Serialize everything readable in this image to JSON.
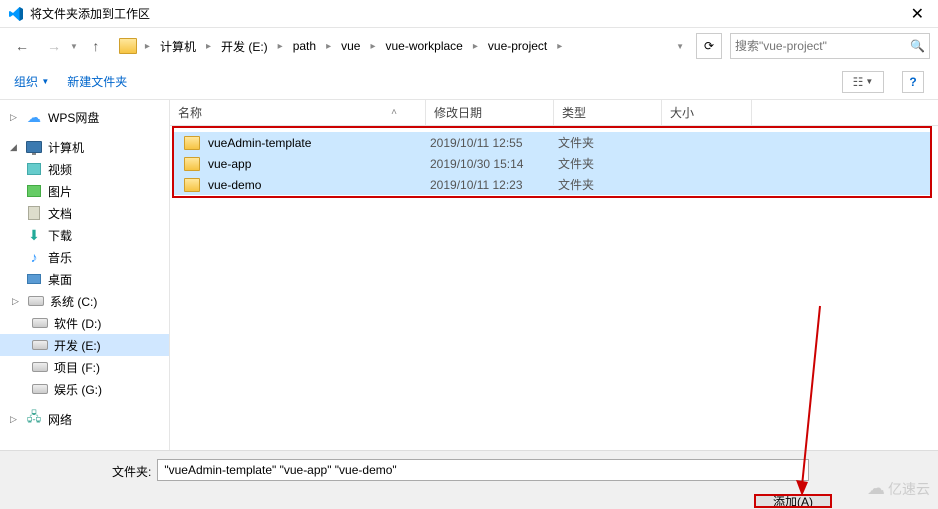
{
  "window": {
    "title": "将文件夹添加到工作区"
  },
  "nav": {
    "breadcrumb": [
      "计算机",
      "开发 (E:)",
      "path",
      "vue",
      "vue-workplace",
      "vue-project"
    ],
    "search_placeholder": "搜索\"vue-project\""
  },
  "toolbar": {
    "organize": "组织",
    "newfolder": "新建文件夹"
  },
  "sidebar": {
    "wps": "WPS网盘",
    "computer": "计算机",
    "items": [
      "视频",
      "图片",
      "文档",
      "下载",
      "音乐",
      "桌面",
      "系统 (C:)",
      "软件 (D:)",
      "开发 (E:)",
      "项目 (F:)",
      "娱乐 (G:)"
    ],
    "network": "网络"
  },
  "columns": {
    "name": "名称",
    "date": "修改日期",
    "type": "类型",
    "size": "大小"
  },
  "files": [
    {
      "name": "vueAdmin-template",
      "date": "2019/10/11 12:55",
      "type": "文件夹"
    },
    {
      "name": "vue-app",
      "date": "2019/10/30 15:14",
      "type": "文件夹"
    },
    {
      "name": "vue-demo",
      "date": "2019/10/11 12:23",
      "type": "文件夹"
    }
  ],
  "footer": {
    "label": "文件夹:",
    "value": "\"vueAdmin-template\" \"vue-app\" \"vue-demo\"",
    "add": "添加(A)"
  },
  "watermark": "亿速云"
}
